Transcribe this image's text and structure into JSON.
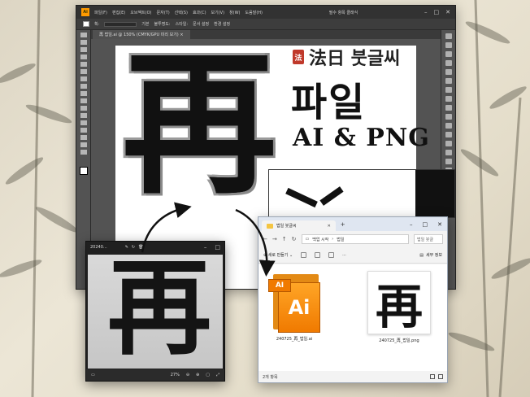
{
  "illustrator": {
    "logo": "Ai",
    "menus": [
      "파일(F)",
      "편집(E)",
      "오브젝트(O)",
      "문자(T)",
      "선택(S)",
      "효과(C)",
      "보기(V)",
      "창(W)",
      "도움말(H)"
    ],
    "workspace": "필수 항목 클래식",
    "options": [
      "획:",
      "기본",
      "불투명도:",
      "스타일:",
      "문서 설정",
      "환경 설정"
    ],
    "doc_tab": "再 법일.ai @ 150% (CMYK/GPU 미리 보기) ×"
  },
  "artboard": {
    "character": "再",
    "seal": "法",
    "brand": "法日 붓글씨",
    "word": "파일",
    "formats": "AI & PNG"
  },
  "photos": {
    "title": "20240...",
    "character": "再",
    "zoom": "27%"
  },
  "explorer": {
    "tab_label": "법일 붓글씨",
    "path": [
      "백업 시작",
      "법일"
    ],
    "search_placeholder": "법일 붓글",
    "new_label": "새로 만들기",
    "details_label": "세부 정보",
    "files": [
      {
        "name": "240725_再_법일.ai",
        "icon": "ai-file-icon",
        "tag": "AI",
        "big": "Ai"
      },
      {
        "name": "240725_再_법일.png",
        "icon": "png-thumbnail",
        "character": "再"
      }
    ],
    "status": "2개 항목"
  },
  "colors": {
    "ai_accent": "#ff9a00",
    "seal": "#c0392b",
    "explorer_tab": "#dfe6f1"
  }
}
